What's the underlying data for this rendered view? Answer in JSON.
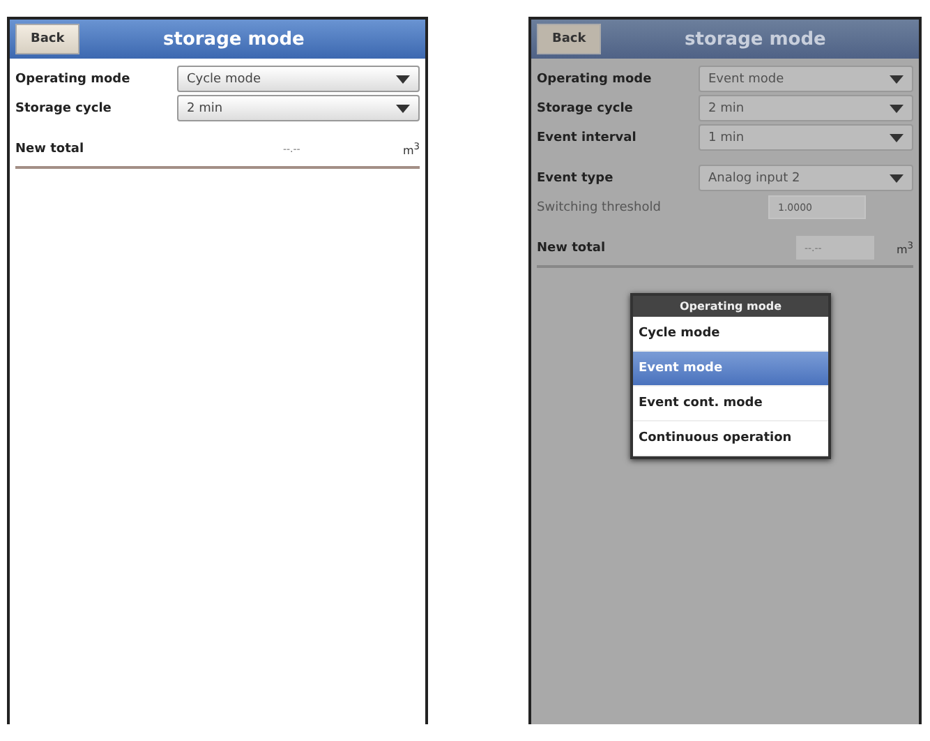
{
  "screens": [
    {
      "back": "Back",
      "title": "storage mode",
      "dimmed": false,
      "groups": [
        {
          "fields": [
            {
              "kind": "select",
              "label": "Operating mode",
              "value": "Cycle mode"
            },
            {
              "kind": "select",
              "label": "Storage cycle",
              "value": "2 min"
            }
          ]
        },
        {
          "fields": [
            {
              "kind": "total",
              "label": "New total",
              "placeholder": "--.--",
              "unit": "m$^{3}$"
            }
          ]
        }
      ]
    },
    {
      "back": "Back",
      "title": "storage mode",
      "dimmed": true,
      "groups": [
        {
          "fields": [
            {
              "kind": "select",
              "label": "Operating mode",
              "value": "Event mode"
            },
            {
              "kind": "select",
              "label": "Storage cycle",
              "value": "2 min"
            },
            {
              "kind": "select",
              "label": "Event interval",
              "value": "1 min"
            }
          ]
        },
        {
          "fields": [
            {
              "kind": "select",
              "label": "Event type",
              "value": "Analog input 2"
            },
            {
              "kind": "param",
              "label": "Switching threshold",
              "value": "1.0000"
            }
          ]
        },
        {
          "fields": [
            {
              "kind": "total",
              "label": "New total",
              "placeholder": "--.--",
              "unit": "m$^{3}$"
            }
          ]
        }
      ],
      "dialog": {
        "title": "Operating mode",
        "options": [
          {
            "label": "Cycle mode",
            "selected": false
          },
          {
            "label": "Event mode",
            "selected": true
          },
          {
            "label": "Event cont. mode",
            "selected": false
          },
          {
            "label": "Continuous operation",
            "selected": false
          }
        ]
      }
    }
  ]
}
